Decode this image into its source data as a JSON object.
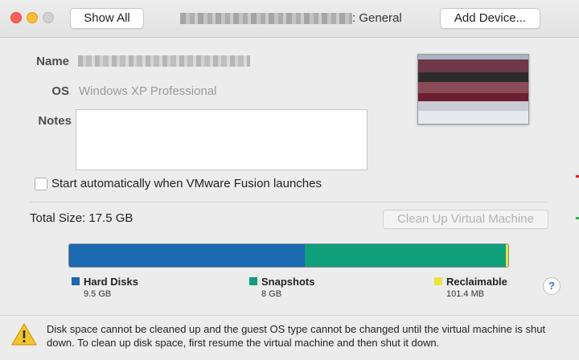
{
  "window": {
    "title": ": General",
    "show_all_label": "Show All",
    "add_device_label": "Add Device..."
  },
  "vm": {
    "name_label": "Name",
    "os_label": "OS",
    "os_value": "Windows XP Professional",
    "notes_label": "Notes",
    "notes_value": "",
    "autostart_label": "Start automatically when VMware Fusion launches",
    "autostart_checked": false
  },
  "storage": {
    "total_size": "Total Size: 17.5 GB",
    "cleanup_label": "Clean Up Virtual Machine",
    "segments": [
      {
        "name": "Hard Disks",
        "size": "9.5 GB",
        "color": "#1a69b1",
        "fraction": 0.537
      },
      {
        "name": "Snapshots",
        "size": "8 GB",
        "color": "#0f9f7a",
        "fraction": 0.457
      },
      {
        "name": "Reclaimable",
        "size": "101.4 MB",
        "color": "#e8e63a",
        "fraction": 0.006
      }
    ]
  },
  "help_label": "?",
  "warning": {
    "icon": "warning-triangle-icon",
    "text": "Disk space cannot be cleaned up and the guest OS type cannot be changed until the virtual machine is shut down. To clean up disk space, first resume the virtual machine and then shut it down."
  }
}
